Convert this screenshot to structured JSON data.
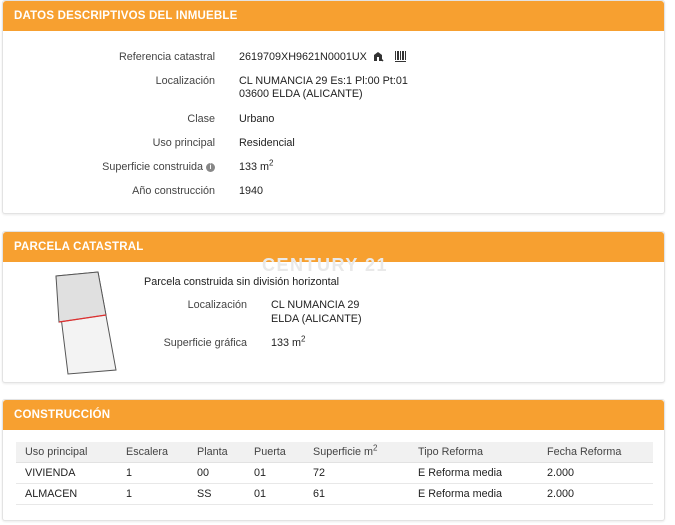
{
  "datos": {
    "title": "DATOS DESCRIPTIVOS DEL INMUEBLE",
    "fields": {
      "referencia_label": "Referencia catastral",
      "referencia_value": "2619709XH9621N0001UX",
      "localizacion_label": "Localización",
      "localizacion_line1": "CL NUMANCIA 29 Es:1 Pl:00 Pt:01",
      "localizacion_line2": "03600 ELDA (ALICANTE)",
      "clase_label": "Clase",
      "clase_value": "Urbano",
      "uso_label": "Uso principal",
      "uso_value": "Residencial",
      "superficie_label": "Superficie construida",
      "superficie_value": "133 m",
      "superficie_sup": "2",
      "ano_label": "Año construcción",
      "ano_value": "1940"
    }
  },
  "parcela": {
    "title": "PARCELA CATASTRAL",
    "desc": "Parcela construida sin división horizontal",
    "localizacion_label": "Localización",
    "localizacion_line1": "CL NUMANCIA 29",
    "localizacion_line2": "ELDA (ALICANTE)",
    "superficie_label": "Superficie gráfica",
    "superficie_value": "133 m",
    "superficie_sup": "2"
  },
  "watermark": "CENTURY 21",
  "construccion": {
    "title": "CONSTRUCCIÓN",
    "columns": [
      "Uso principal",
      "Escalera",
      "Planta",
      "Puerta",
      "Superficie m",
      "Tipo Reforma",
      "Fecha Reforma"
    ],
    "superficie_sup": "2",
    "rows": [
      [
        "VIVIENDA",
        "1",
        "00",
        "01",
        "72",
        "E Reforma media",
        "2.000"
      ],
      [
        "ALMACEN",
        "1",
        "SS",
        "01",
        "61",
        "E Reforma media",
        "2.000"
      ]
    ]
  },
  "colors": {
    "header": "#f7a030",
    "plot_fill": "#e0e0e0",
    "plot_line": "#e03030"
  },
  "icons": [
    "map-location-icon",
    "barcode-icon",
    "info-icon"
  ]
}
